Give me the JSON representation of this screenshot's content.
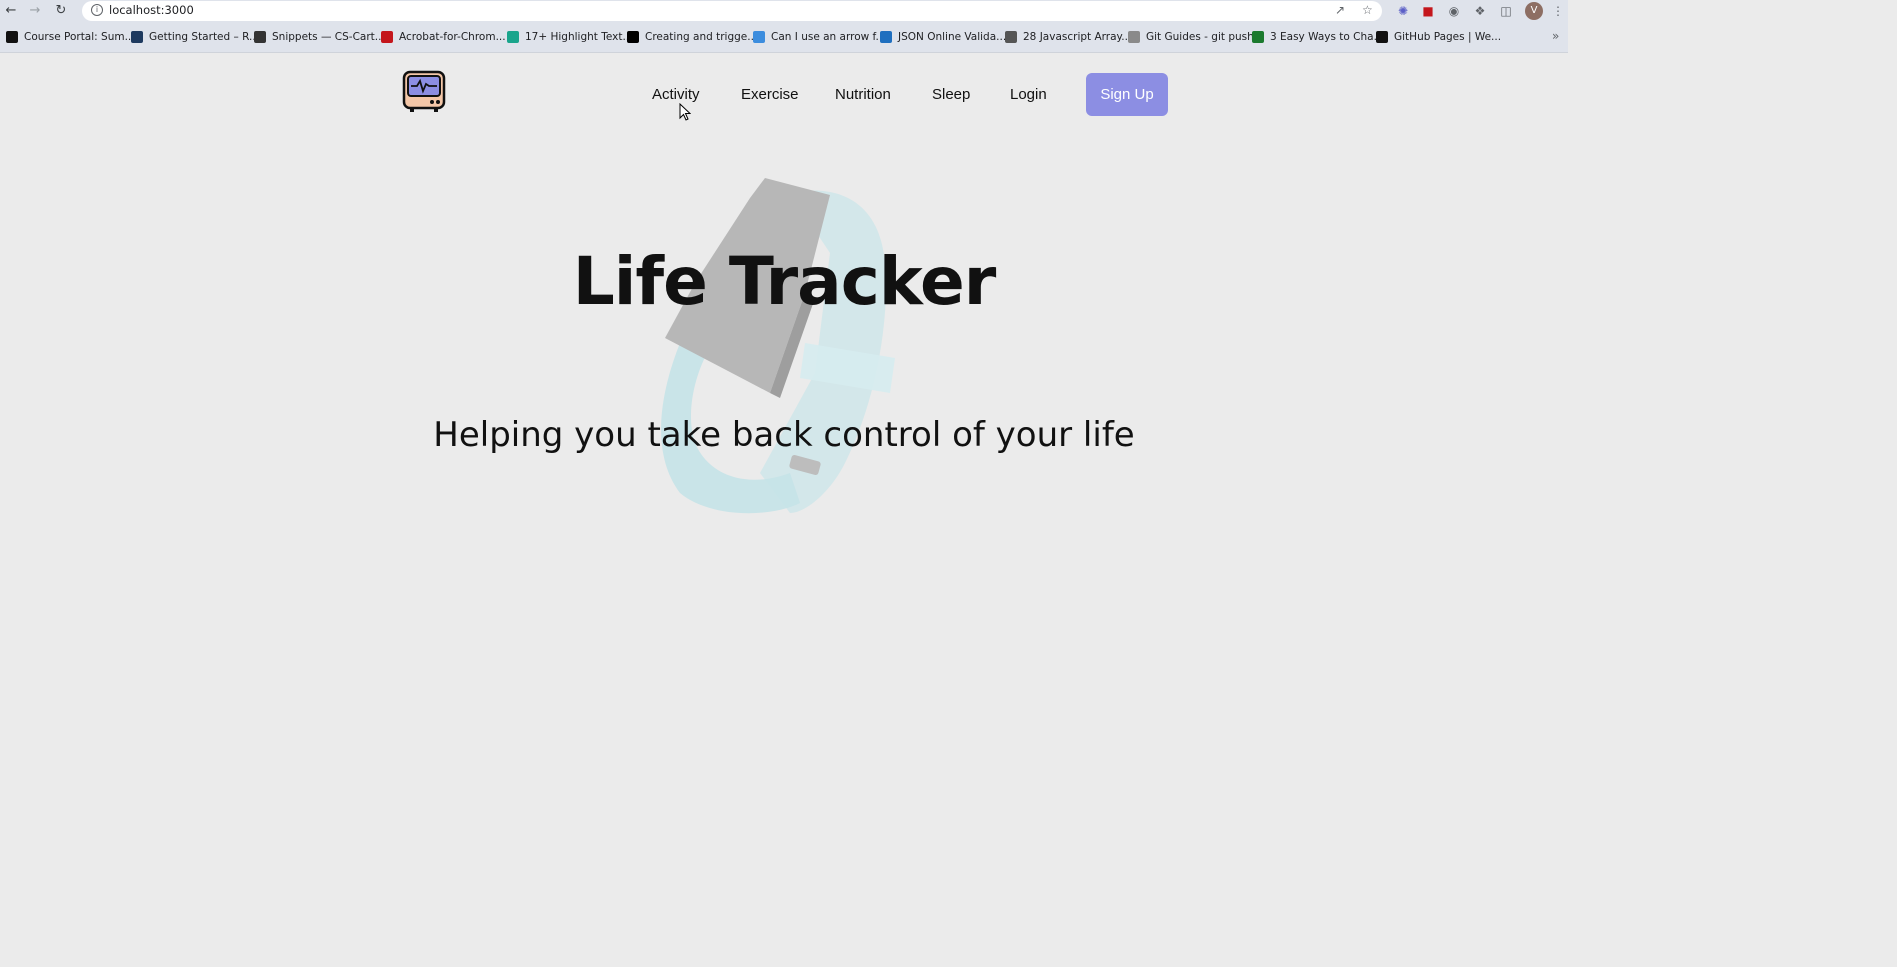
{
  "browser": {
    "url": "localhost:3000",
    "avatar_letter": "V",
    "bookmarks": [
      {
        "label": "Course Portal: Sum...",
        "color": "#111111"
      },
      {
        "label": "Getting Started – R...",
        "color": "#1e3a5f"
      },
      {
        "label": "Snippets — CS-Cart...",
        "color": "#333333"
      },
      {
        "label": "Acrobat-for-Chrom...",
        "color": "#c4161c"
      },
      {
        "label": "17+ Highlight Text...",
        "color": "#1aa58c"
      },
      {
        "label": "Creating and trigge...",
        "color": "#000000"
      },
      {
        "label": "Can I use an arrow f...",
        "color": "#3c8dde"
      },
      {
        "label": "JSON Online Valida...",
        "color": "#1f6fbf"
      },
      {
        "label": "28 Javascript Array...",
        "color": "#555555"
      },
      {
        "label": "Git Guides - git push",
        "color": "#8a8a8a"
      },
      {
        "label": "3 Easy Ways to Cha...",
        "color": "#1b7a2e"
      },
      {
        "label": "GitHub Pages | We...",
        "color": "#111111"
      }
    ]
  },
  "navbar": {
    "links": [
      "Activity",
      "Exercise",
      "Nutrition",
      "Sleep",
      "Login"
    ],
    "signup_label": "Sign Up",
    "accent": "#8c8ee3"
  },
  "hero": {
    "title": "Life Tracker",
    "subtitle": "Helping you take back control of your life"
  }
}
